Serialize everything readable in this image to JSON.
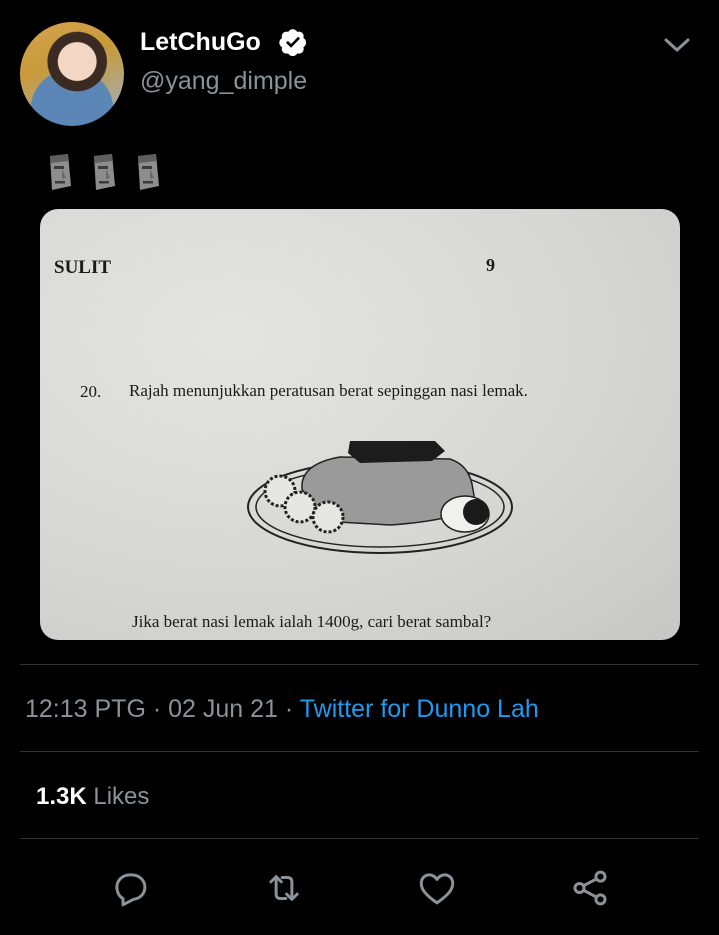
{
  "tweet": {
    "display_name": "LetChuGo",
    "handle": "@yang_dimple",
    "verified": true,
    "emoji_text": "🗿🗿🗿",
    "time": "12:13 PTG",
    "date": "02 Jun 21",
    "source": "Twitter for Dunno Lah",
    "likes_count": "1.3K",
    "likes_label": "Likes"
  },
  "image": {
    "header_left": "SULIT",
    "page_number": "9",
    "question_number": "20.",
    "question_text": "Rajah menunjukkan peratusan berat sepinggan nasi lemak.",
    "question_sub": "Jika berat nasi lemak ialah 1400g, cari berat sambal?"
  },
  "icons": {
    "verified": "verified-badge-icon",
    "menu": "chevron-down-icon",
    "reply": "reply-icon",
    "retweet": "retweet-icon",
    "like": "heart-icon",
    "share": "share-icon"
  },
  "colors": {
    "background": "#000000",
    "accent": "#1d9bf0",
    "secondary_text": "#8b9299",
    "divider": "#2f3336"
  }
}
